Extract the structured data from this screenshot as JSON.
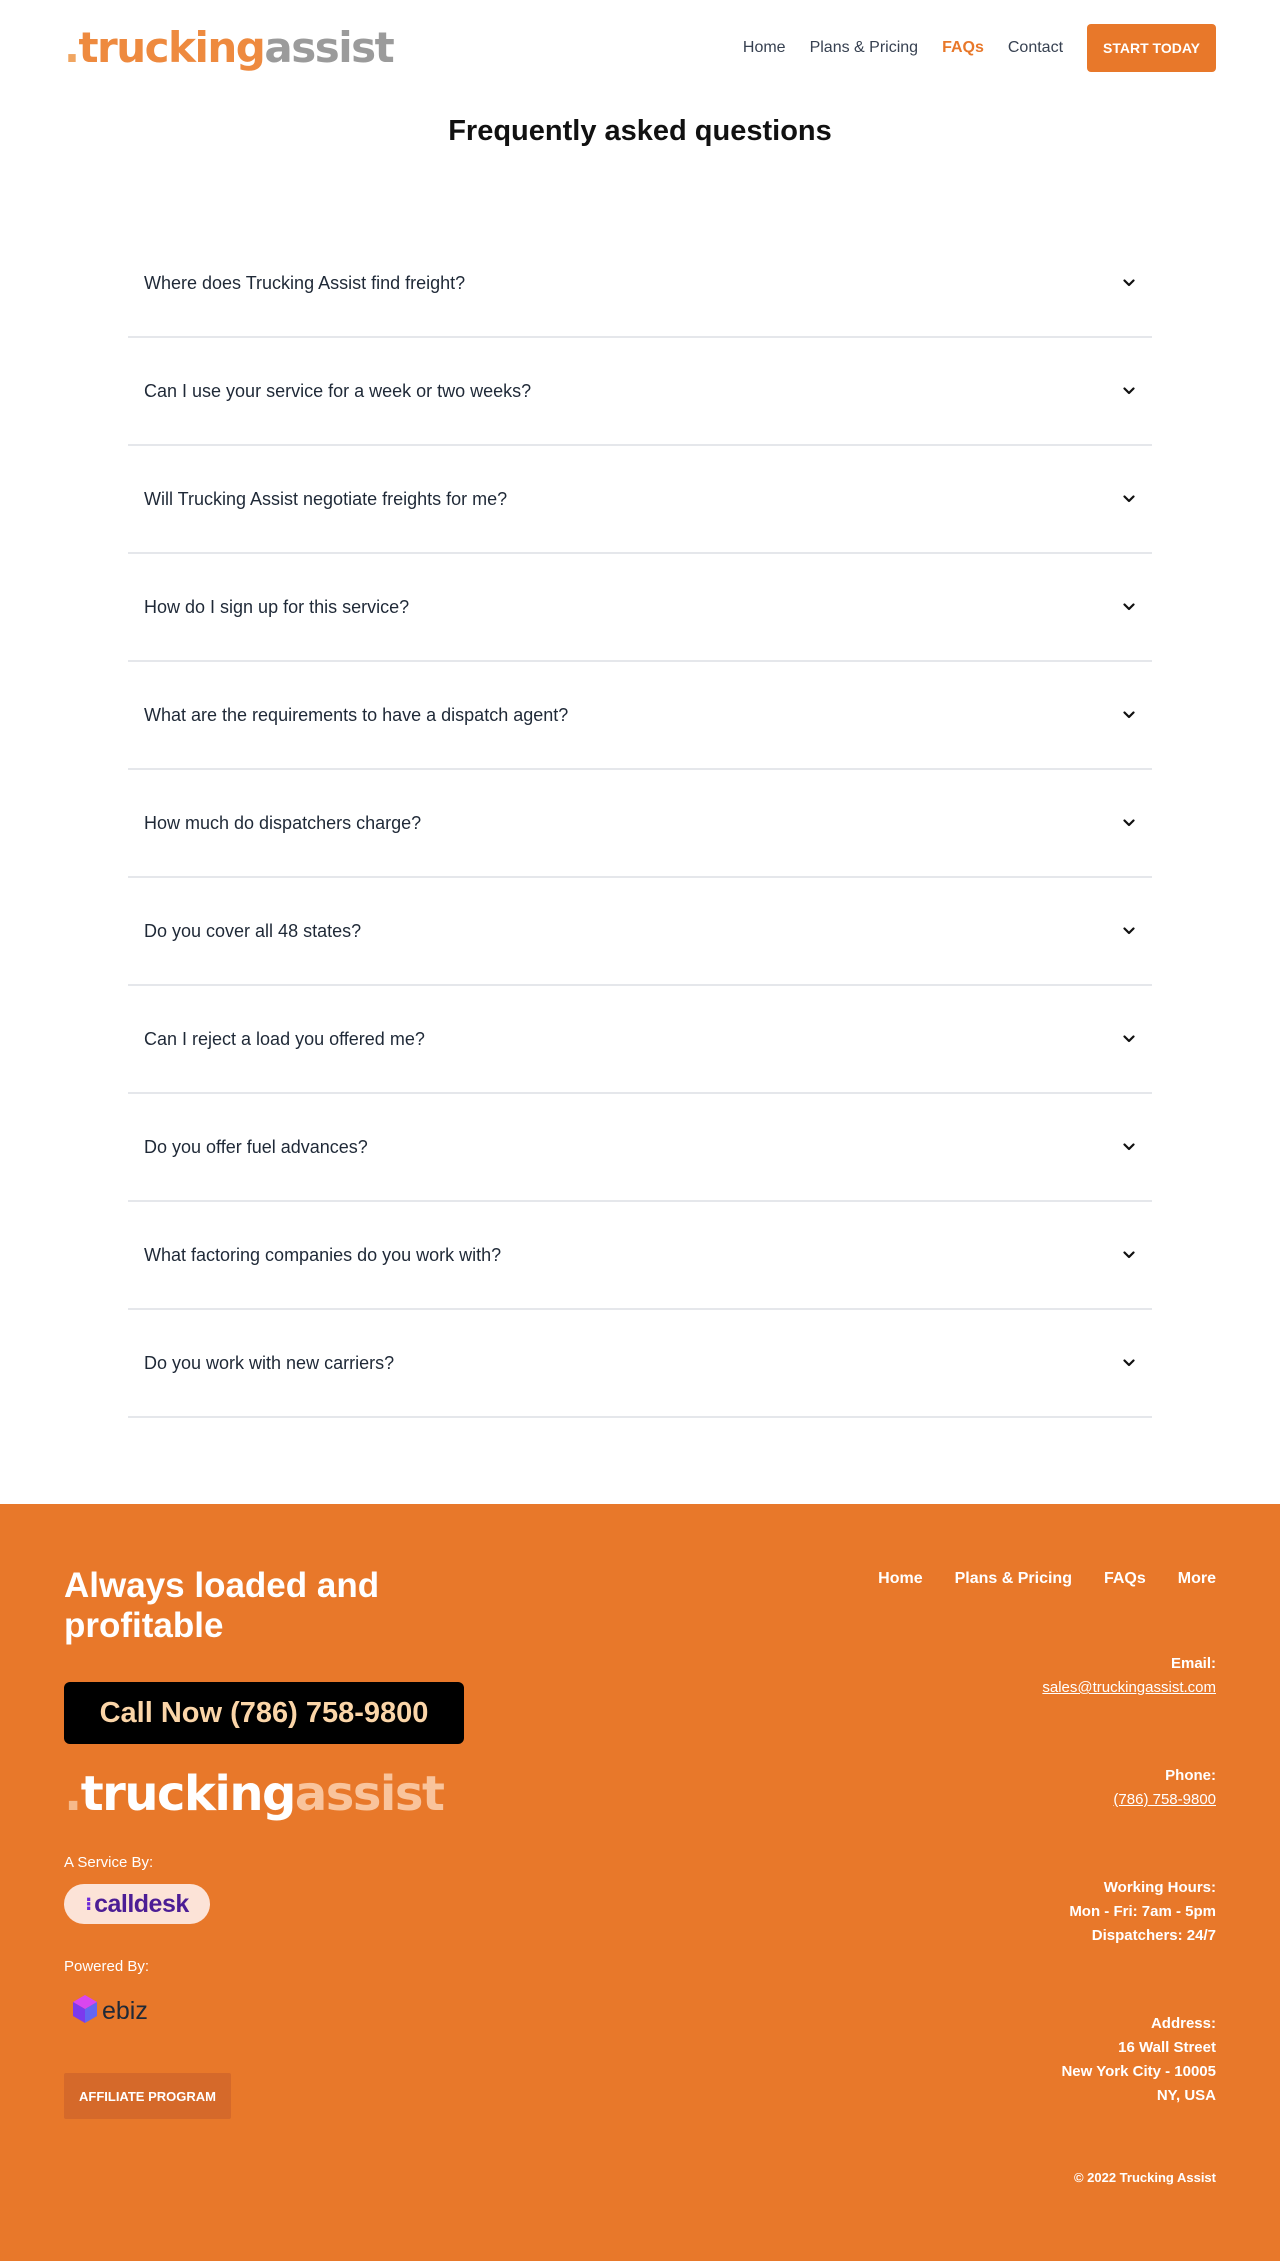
{
  "header": {
    "logo": {
      "dot": ".",
      "part1": "trucking",
      "part2": "assist"
    },
    "nav": [
      {
        "label": "Home",
        "active": false
      },
      {
        "label": "Plans & Pricing",
        "active": false
      },
      {
        "label": "FAQs",
        "active": true
      },
      {
        "label": "Contact",
        "active": false
      }
    ],
    "cta_label": "START TODAY"
  },
  "faq": {
    "title": "Frequently asked questions",
    "questions": [
      "Where does Trucking Assist find freight?",
      "Can I use your service for a week or two weeks?",
      "Will Trucking Assist negotiate freights for me?",
      "How do I sign up for this service?",
      "What are the requirements to have a dispatch agent?",
      "How much do dispatchers charge?",
      "Do you cover all 48 states?",
      "Can I reject a load you offered me?",
      "Do you offer fuel advances?",
      "What factoring companies do you work with?",
      "Do you work with new carriers?"
    ]
  },
  "footer": {
    "tagline": "Always loaded and profitable",
    "call_button": "Call Now (786) 758-9800",
    "logo": {
      "dot": ".",
      "part1": "trucking",
      "part2": "assist"
    },
    "service_label": "A Service By:",
    "calldesk": "calldesk",
    "powered_label": "Powered By:",
    "ebiz": "ebiz",
    "affiliate_label": "AFFILIATE PROGRAM",
    "nav": [
      "Home",
      "Plans & Pricing",
      "FAQs",
      "More"
    ],
    "email_label": "Email:",
    "email": "sales@truckingassist.com",
    "phone_label": "Phone:",
    "phone": "(786) 758-9800",
    "hours_label": "Working Hours:",
    "hours_line1": "Mon - Fri: 7am - 5pm",
    "hours_line2": "Dispatchers: 24/7",
    "address_label": "Address:",
    "address_line1": "16 Wall Street",
    "address_line2": "New York City - 10005",
    "address_line3": "NY, USA",
    "copyright": "© 2022 Trucking Assist"
  },
  "colors": {
    "accent": "#e8782a",
    "logo_orange": "#ee8a3f",
    "logo_gray": "#9b9b9b",
    "call_button_bg": "#000000",
    "call_button_text": "#fbd5a8",
    "calldesk_purple": "#4c1d95"
  },
  "icons": {
    "faq_toggle": "chevron-down-icon",
    "ebiz_logo": "ebiz-cube-icon"
  }
}
